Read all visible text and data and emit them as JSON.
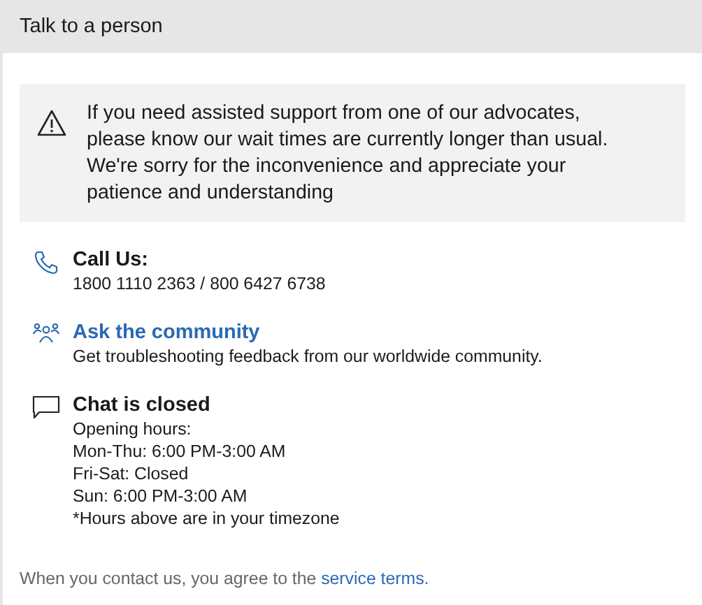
{
  "header": {
    "title": "Talk to a person"
  },
  "notice": {
    "text": "If you need assisted support from one of our advocates, please know our wait times are currently longer than usual. We're sorry for the inconvenience and appreciate your patience and understanding"
  },
  "contacts": [
    {
      "kind": "phone",
      "title": "Call Us:",
      "link": false,
      "lines": [
        "1800 1110 2363 / 800 6427 6738"
      ]
    },
    {
      "kind": "community",
      "title": "Ask the community",
      "link": true,
      "lines": [
        "Get troubleshooting feedback from our worldwide community."
      ]
    },
    {
      "kind": "chat",
      "title": "Chat is closed",
      "link": false,
      "lines": [
        "Opening hours:",
        "Mon-Thu: 6:00 PM-3:00 AM",
        "Fri-Sat: Closed",
        "Sun: 6:00 PM-3:00 AM",
        "*Hours above are in your timezone"
      ]
    }
  ],
  "footer": {
    "text": "When you contact us, you agree to the",
    "link": "service terms."
  }
}
